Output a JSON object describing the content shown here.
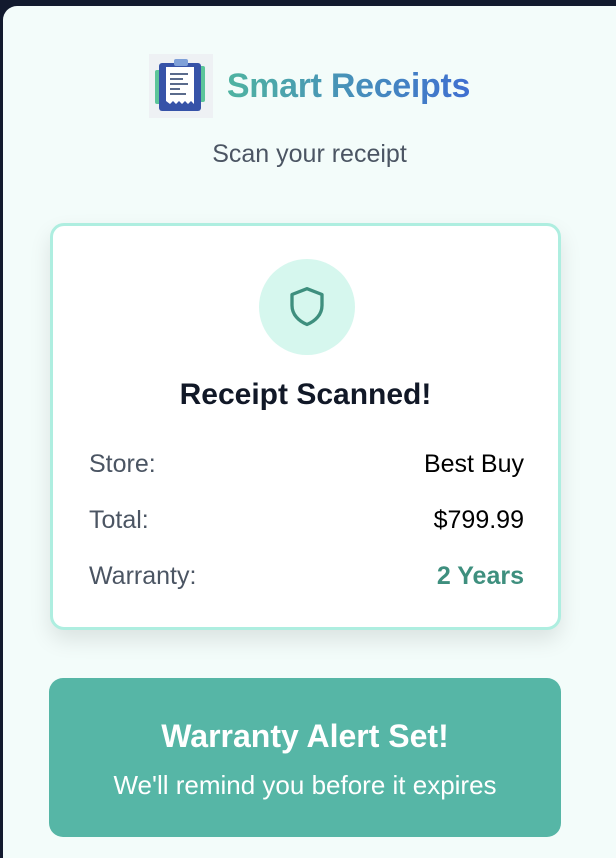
{
  "app": {
    "title": "Smart Receipts",
    "subtitle": "Scan your receipt",
    "logo_icon": "receipt-clipboard-icon"
  },
  "result_card": {
    "icon": "shield-icon",
    "title": "Receipt Scanned!",
    "rows": [
      {
        "label": "Store:",
        "value": "Best Buy"
      },
      {
        "label": "Total:",
        "value": "$799.99"
      },
      {
        "label": "Warranty:",
        "value": "2 Years"
      }
    ]
  },
  "alert": {
    "title": "Warranty Alert Set!",
    "message": "We'll remind you before it expires"
  },
  "colors": {
    "accent": "#56b6a6",
    "accent_text": "#3e8f7e",
    "card_border": "#aeeee0",
    "title_gradient_start": "#4fb3a1",
    "title_gradient_end": "#3f6fd1"
  }
}
